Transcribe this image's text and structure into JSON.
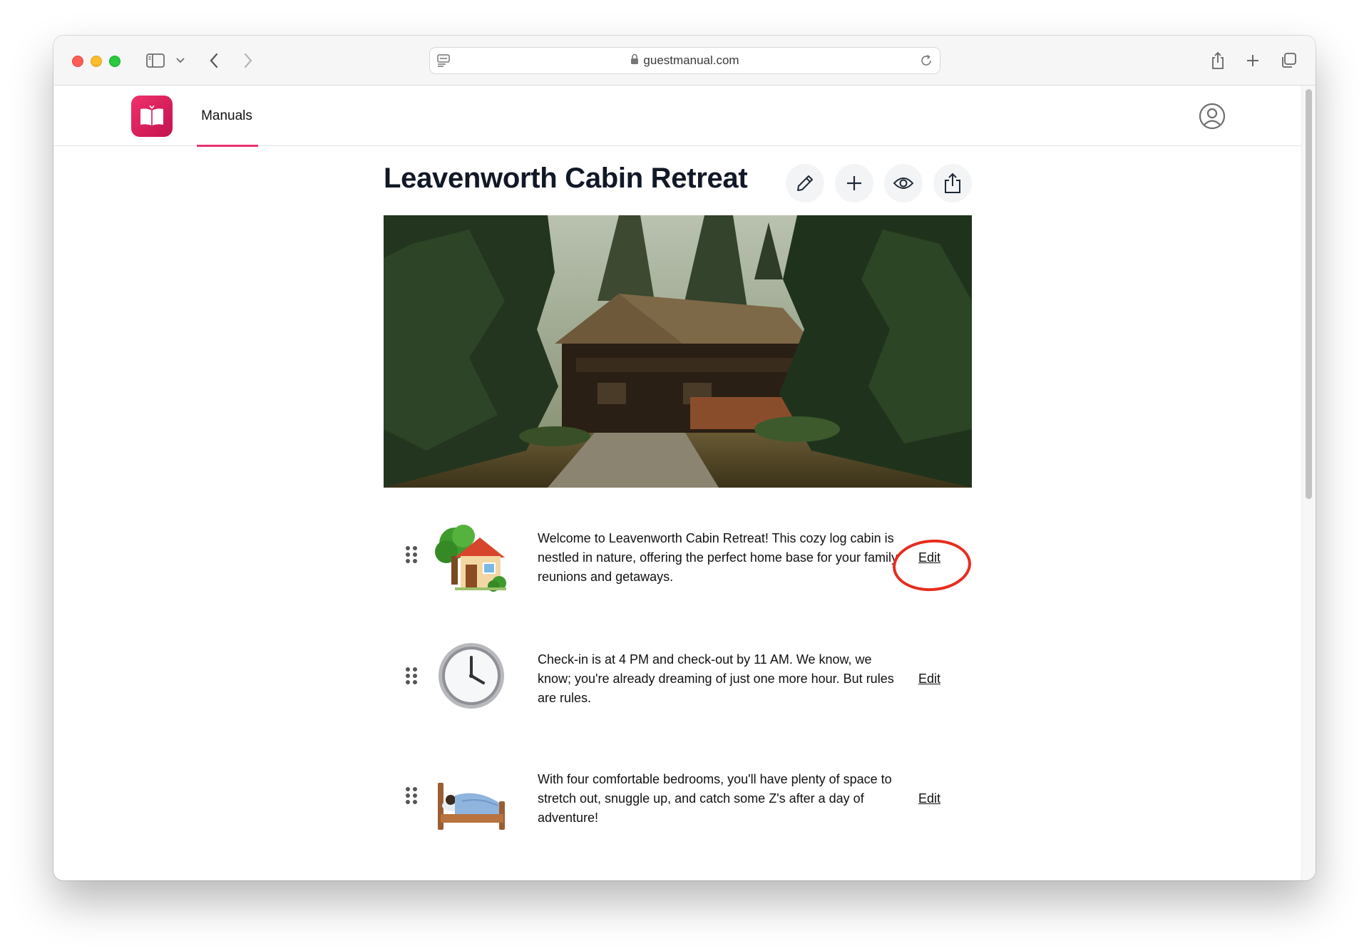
{
  "browser": {
    "url": "guestmanual.com"
  },
  "nav": {
    "manuals_label": "Manuals"
  },
  "page": {
    "title": "Leavenworth Cabin Retreat"
  },
  "items": [
    {
      "icon": "house-with-tree-icon",
      "text": "Welcome to Leavenworth Cabin Retreat! This cozy log cabin is nestled in nature, offering the perfect home base for your family reunions and getaways.",
      "edit_label": "Edit"
    },
    {
      "icon": "clock-icon",
      "text": "Check-in is at 4 PM and check-out by 11 AM. We know, we know; you're already dreaming of just one more hour. But rules are rules.",
      "edit_label": "Edit"
    },
    {
      "icon": "bed-icon",
      "text": "With four comfortable bedrooms, you'll have plenty of space to stretch out, snuggle up, and catch some Z's after a day of adventure!",
      "edit_label": "Edit"
    }
  ],
  "colors": {
    "brand": "#e8336e",
    "highlight_annotation": "#e82c1e"
  }
}
